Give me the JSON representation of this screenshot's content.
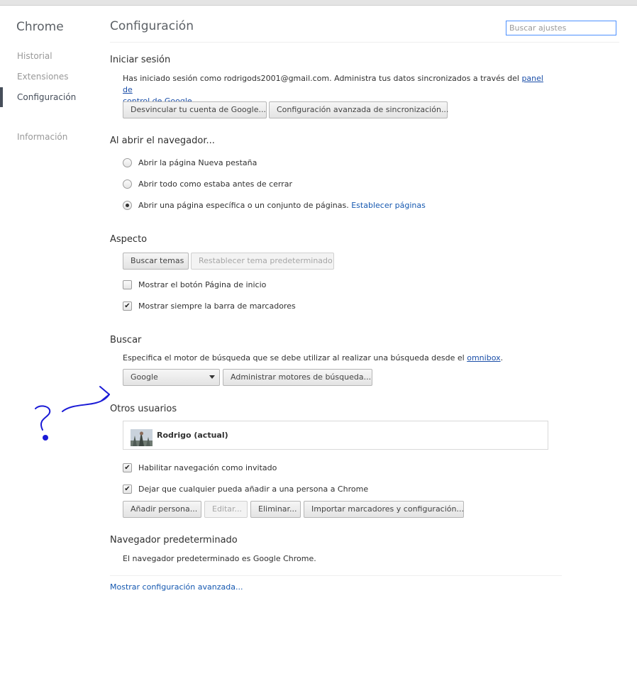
{
  "sidebar": {
    "brand": "Chrome",
    "items": [
      {
        "label": "Historial"
      },
      {
        "label": "Extensiones"
      },
      {
        "label": "Configuración"
      },
      {
        "label": "Información"
      }
    ]
  },
  "header": {
    "title": "Configuración",
    "search_placeholder": "Buscar ajustes"
  },
  "signin": {
    "heading": "Iniciar sesión",
    "text_before": "Has iniciado sesión como rodrigods2001@gmail.com. Administra tus datos sincronizados a través del ",
    "link_part1": "panel de",
    "link_part2": "control de Google",
    "text_after": ".",
    "btn_disconnect": "Desvincular tu cuenta de Google...",
    "btn_advanced_sync": "Configuración avanzada de sincronización..."
  },
  "startup": {
    "heading": "Al abrir el navegador...",
    "options": [
      {
        "label": "Abrir la página Nueva pestaña",
        "checked": false
      },
      {
        "label": "Abrir todo como estaba antes de cerrar",
        "checked": false
      },
      {
        "label": "Abrir una página específica o un conjunto de páginas.",
        "checked": true
      }
    ],
    "set_pages_link": "Establecer páginas"
  },
  "appearance": {
    "heading": "Aspecto",
    "btn_themes": "Buscar temas",
    "btn_reset_theme": "Restablecer tema predeterminado",
    "checkboxes": [
      {
        "label": "Mostrar el botón Página de inicio",
        "checked": false
      },
      {
        "label": "Mostrar siempre la barra de marcadores",
        "checked": true
      }
    ]
  },
  "search": {
    "heading": "Buscar",
    "text_before": "Especifica el motor de búsqueda que se debe utilizar al realizar una búsqueda desde el ",
    "omnibox_link": "omnibox",
    "text_after": ".",
    "engine_selected": "Google",
    "btn_manage": "Administrar motores de búsqueda..."
  },
  "users": {
    "heading": "Otros usuarios",
    "profile_name": "Rodrigo (actual)",
    "checkboxes": [
      {
        "label": "Habilitar navegación como invitado",
        "checked": true
      },
      {
        "label": "Dejar que cualquier pueda añadir a una persona a Chrome",
        "checked": true
      }
    ],
    "btn_add": "Añadir persona...",
    "btn_edit": "Editar...",
    "btn_remove": "Eliminar...",
    "btn_import": "Importar marcadores y configuración..."
  },
  "default_browser": {
    "heading": "Navegador predeterminado",
    "text": "El navegador predeterminado es Google Chrome."
  },
  "advanced_link": "Mostrar configuración avanzada...",
  "colors": {
    "link": "#1a4ea8",
    "annotation": "#1a1ad6",
    "focus_border": "#4d90fe"
  }
}
